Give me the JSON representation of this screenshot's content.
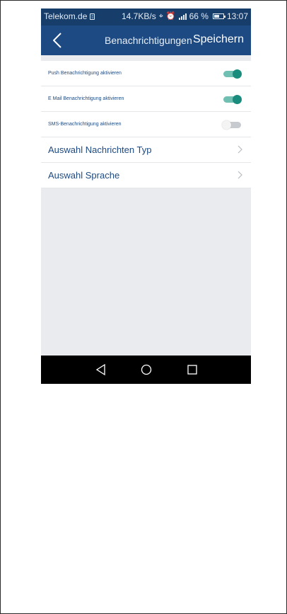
{
  "status_bar": {
    "carrier": "Telekom.de",
    "sim_icon": "sim-icon",
    "speed": "14.7KB/s",
    "lte_label": "LTE",
    "battery_percent": "66 %",
    "battery_level": 0.66,
    "time": "13:07"
  },
  "header": {
    "title": "Benachrichtigungen",
    "save_label": "Speichern",
    "back_icon": "chevron-left-icon",
    "bg_color": "#1d4a82"
  },
  "toggles": [
    {
      "label": "Push Benachrichtigung aktivieren",
      "on": true
    },
    {
      "label": "E Mail Benachrichtigung aktivieren",
      "on": true
    },
    {
      "label": "SMS-Benachrichtigung aktivieren",
      "on": false
    }
  ],
  "nav_items": [
    {
      "label": "Auswahl Nachrichten Typ",
      "icon": "chevron-right-icon"
    },
    {
      "label": "Auswahl Sprache",
      "icon": "chevron-right-icon"
    }
  ],
  "android_nav": {
    "buttons": [
      "back-triangle-icon",
      "home-circle-icon",
      "recents-square-icon"
    ]
  },
  "colors": {
    "accent_teal": "#1a8c7e",
    "text_blue": "#1d4a82",
    "background_gray": "#e9ebee"
  }
}
